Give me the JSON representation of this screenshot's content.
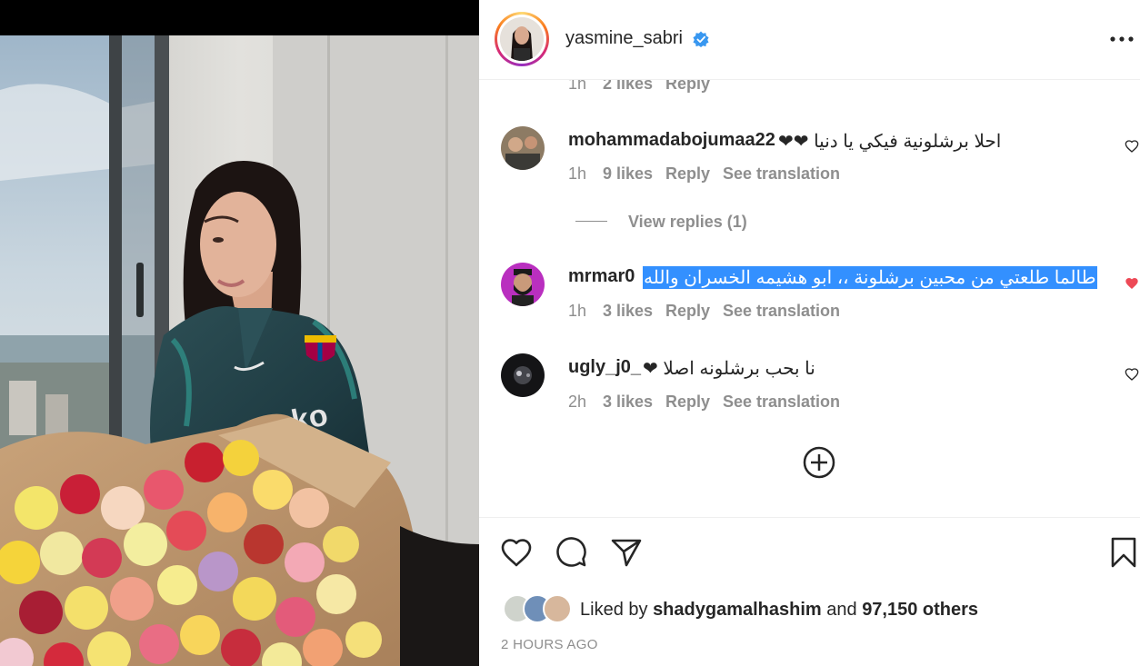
{
  "post": {
    "author": "yasmine_sabri",
    "verified_icon": "verified-badge-icon",
    "more_icon": "more-options-icon"
  },
  "comments": [
    {
      "time": "1h",
      "likes": "2 likes",
      "reply": "Reply"
    },
    {
      "username": "mohammadabojumaa22",
      "text": "احلا برشلونية فيكي يا دنيا ❤❤",
      "time": "1h",
      "likes": "9 likes",
      "reply": "Reply",
      "translation": "See translation",
      "liked": false
    },
    {
      "username": "mrmar0",
      "text": "طالما طلعتي من محبين برشلونة ،، ابو هشيمه الخسران والله",
      "time": "1h",
      "likes": "3 likes",
      "reply": "Reply",
      "translation": "See translation",
      "liked": true,
      "text_selected": true
    },
    {
      "username": "ugly_j0_",
      "text": "نا بحب برشلونه اصلا ❤",
      "time": "2h",
      "likes": "3 likes",
      "reply": "Reply",
      "translation": "See translation",
      "liked": false
    }
  ],
  "view_replies": "View replies (1)",
  "load_more_icon": "plus-circle-icon",
  "actions": {
    "like_icon": "heart-icon",
    "comment_icon": "comment-icon",
    "share_icon": "send-icon",
    "save_icon": "bookmark-icon"
  },
  "likes": {
    "prefix": "Liked by",
    "user": "shadygamalhashim",
    "and": "and",
    "others": "97,150 others"
  },
  "posted": "2 HOURS AGO",
  "colors": {
    "accent_red": "#ed4956",
    "verified_blue": "#3897f0",
    "selection_blue": "#3390ff",
    "muted_text": "#8e8e8e"
  }
}
